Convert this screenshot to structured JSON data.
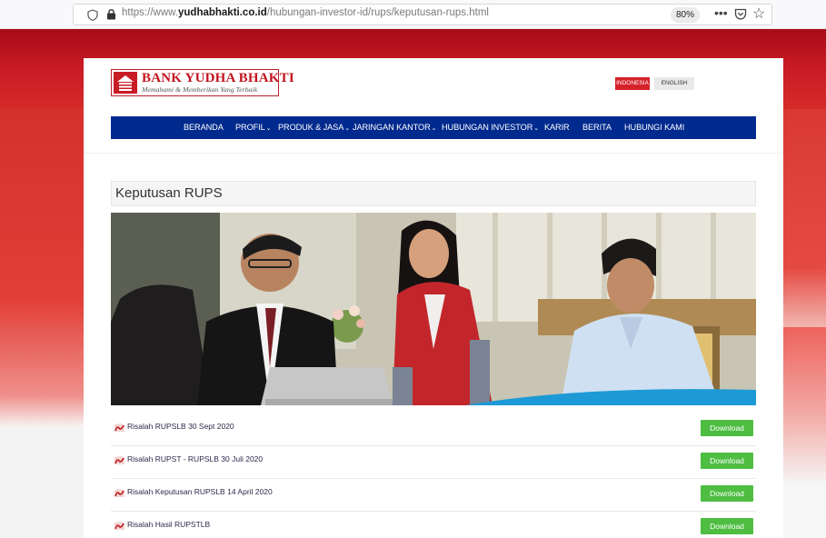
{
  "browser": {
    "url_prefix": "https://www.",
    "url_domain": "yudhabhakti.co.id",
    "url_path": "/hubungan-investor-id/rups/keputusan-rups.html",
    "zoom": "80%",
    "icons": [
      "shield-icon",
      "lock-icon",
      "more-icon",
      "pocket-icon",
      "bookmark-star-icon"
    ]
  },
  "site": {
    "bank_name": "BANK YUDHA BHAKTI",
    "tagline": "Memahami & Memberikan Yang Terbaik",
    "lang_id": "INDONESIA",
    "lang_en": "ENGLISH",
    "brand_red": "#c81d25",
    "nav_blue": "#002a8e"
  },
  "nav": {
    "beranda": "BERANDA",
    "profil": "PROFIL",
    "produk": "PRODUK & JASA",
    "jaringan": "JARINGAN KANTOR",
    "investor": "HUBUNGAN INVESTOR",
    "karir": "KARIR",
    "berita": "BERITA",
    "kontak": "HUBUNGI KAMI",
    "caret": "⌄"
  },
  "page": {
    "title": "Keputusan RUPS"
  },
  "documents": [
    {
      "label": "Risalah RUPSLB 30 Sept 2020",
      "button": "Download"
    },
    {
      "label": "Risalah RUPST - RUPSLB 30 Juli 2020",
      "button": "Download"
    },
    {
      "label": "Risalah Keputusan RUPSLB 14 April 2020",
      "button": "Download"
    },
    {
      "label": "Risalah Hasil RUPSTLB",
      "button": "Download"
    }
  ]
}
